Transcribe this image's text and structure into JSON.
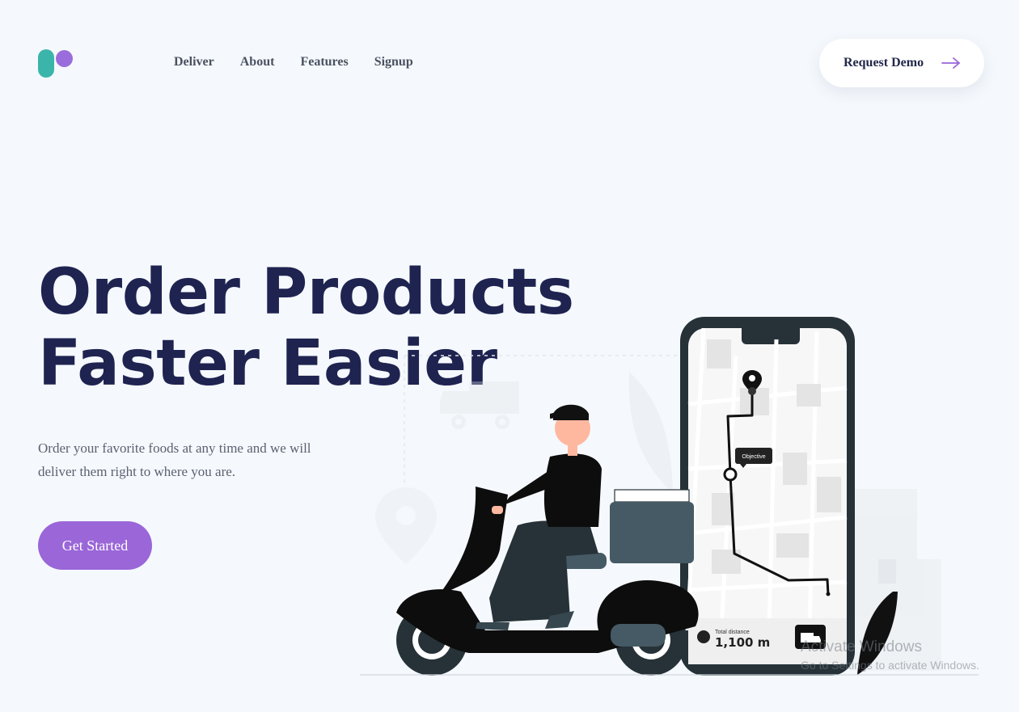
{
  "nav": {
    "items": [
      {
        "label": "Deliver"
      },
      {
        "label": "About"
      },
      {
        "label": "Features"
      },
      {
        "label": "Signup"
      }
    ]
  },
  "header": {
    "demo_label": "Request Demo",
    "arrow_icon": "arrow-right-icon"
  },
  "hero": {
    "title_line1": "Order Products",
    "title_line2": "Faster Easier",
    "subtitle": "Order your favorite foods at any time and we will deliver them right to where you are.",
    "cta_label": "Get Started"
  },
  "illustration": {
    "tooltip_label": "Objective",
    "distance_caption": "Total distance",
    "distance_value": "1,100 m"
  },
  "watermark": {
    "line1": "Activate Windows",
    "line2": "Go to Settings to activate Windows."
  },
  "colors": {
    "brand_purple": "#9a66d8",
    "brand_teal": "#3bb5a9",
    "heading_navy": "#1f2350",
    "background": "#f5f9fd"
  }
}
